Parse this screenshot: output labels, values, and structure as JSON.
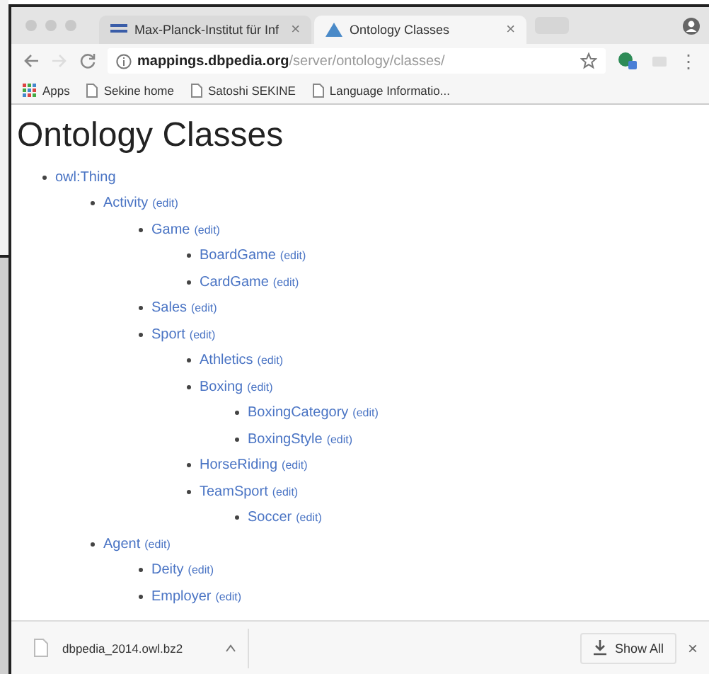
{
  "tabs": [
    {
      "title": "Max-Planck-Institut für Inf",
      "close": "×",
      "selected": false
    },
    {
      "title": "Ontology Classes",
      "close": "×",
      "selected": true
    }
  ],
  "address_bar": {
    "host": "mappings.dbpedia.org",
    "path": "/server/ontology/classes/",
    "forward_disabled": true
  },
  "menu_glyph": "⋮",
  "bookmarks": [
    {
      "kind": "apps",
      "label": "Apps"
    },
    {
      "kind": "page",
      "label": "Sekine home"
    },
    {
      "kind": "page",
      "label": "Satoshi SEKINE"
    },
    {
      "kind": "page",
      "label": "Language Informatio..."
    }
  ],
  "heading": "Ontology Classes",
  "tree": [
    {
      "label": "owl:Thing",
      "children": [
        {
          "label": "Activity",
          "edit": "(edit)",
          "children": [
            {
              "label": "Game",
              "edit": "(edit)",
              "children": [
                {
                  "label": "BoardGame",
                  "edit": "(edit)"
                },
                {
                  "label": "CardGame",
                  "edit": "(edit)"
                }
              ]
            },
            {
              "label": "Sales",
              "edit": "(edit)"
            },
            {
              "label": "Sport",
              "edit": "(edit)",
              "children": [
                {
                  "label": "Athletics",
                  "edit": "(edit)"
                },
                {
                  "label": "Boxing",
                  "edit": "(edit)",
                  "children": [
                    {
                      "label": "BoxingCategory",
                      "edit": "(edit)"
                    },
                    {
                      "label": "BoxingStyle",
                      "edit": "(edit)"
                    }
                  ]
                },
                {
                  "label": "HorseRiding",
                  "edit": "(edit)"
                },
                {
                  "label": "TeamSport",
                  "edit": "(edit)",
                  "children": [
                    {
                      "label": "Soccer",
                      "edit": "(edit)"
                    }
                  ]
                }
              ]
            }
          ]
        },
        {
          "label": "Agent",
          "edit": "(edit)",
          "children": [
            {
              "label": "Deity",
              "edit": "(edit)"
            },
            {
              "label": "Employer",
              "edit": "(edit)"
            }
          ]
        }
      ]
    }
  ],
  "download_bar": {
    "file": "dbpedia_2014.owl.bz2",
    "show_all": "Show All",
    "close": "×"
  }
}
